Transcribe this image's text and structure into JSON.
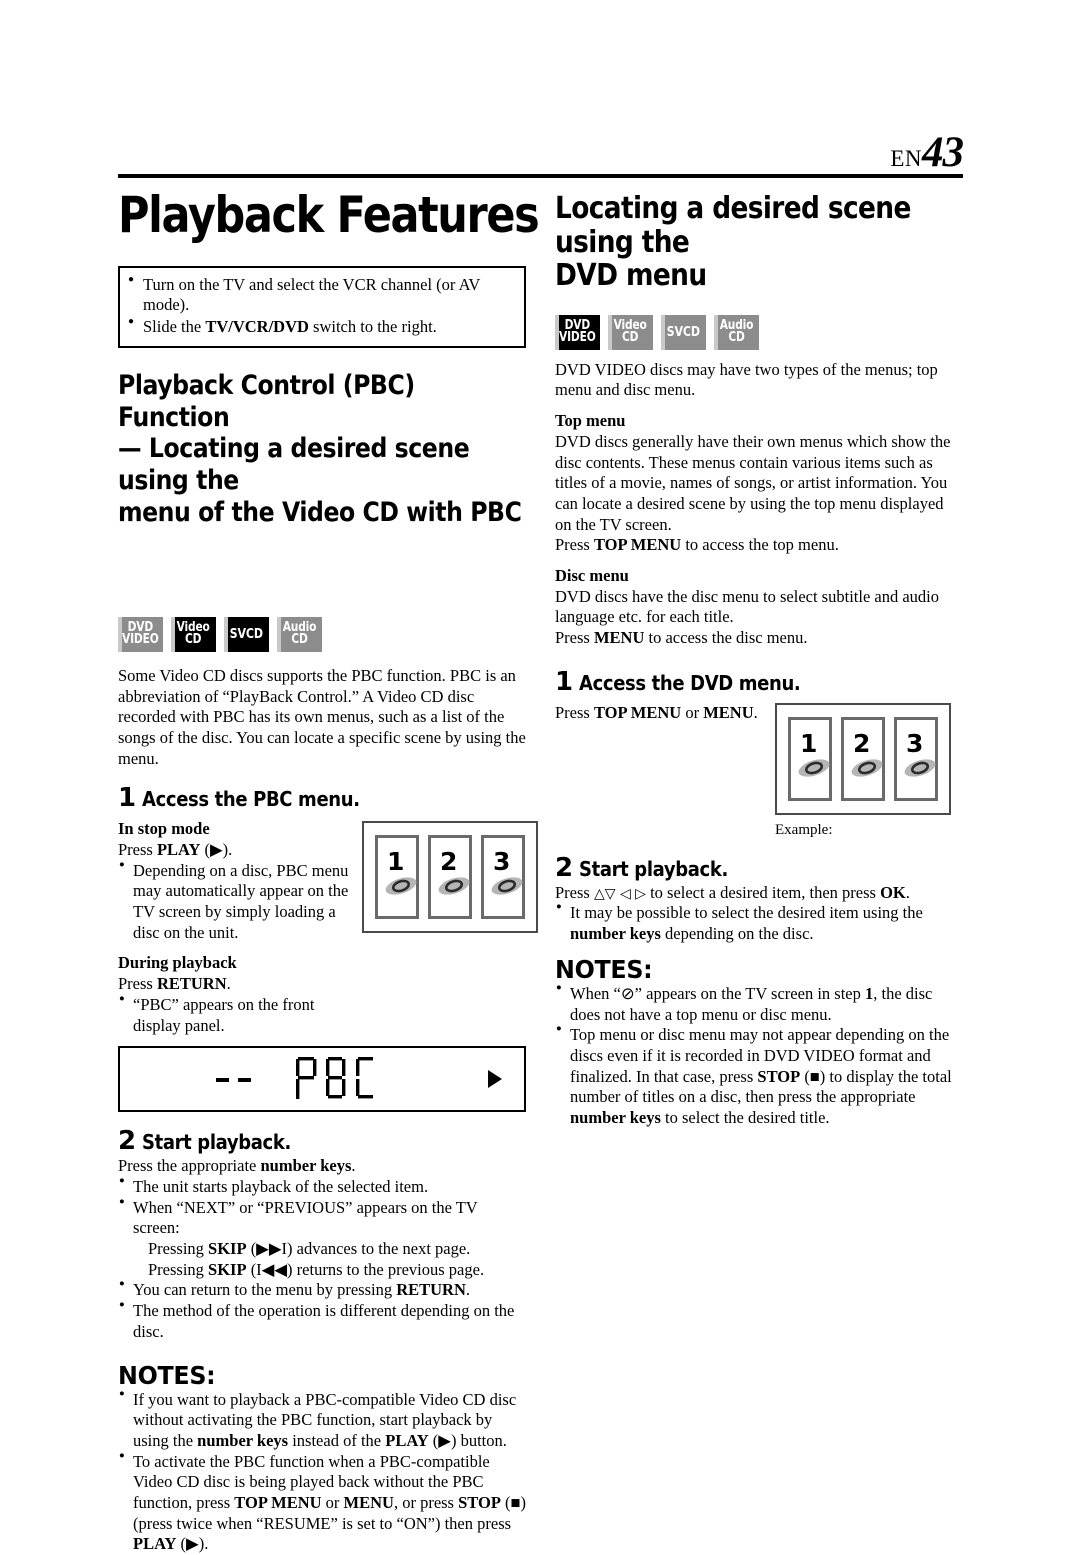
{
  "header": {
    "lang": "EN",
    "page_number": "43"
  },
  "left": {
    "title": "Playback Features",
    "prep_box": [
      "Turn on the TV and select the VCR channel (or AV mode).",
      "Slide the TV/VCR/DVD switch to the right."
    ],
    "prep_box_parts": {
      "b1_text": "Turn on the TV and select the VCR channel (or AV mode).",
      "b2_pre": "Slide the ",
      "b2_bold": "TV/VCR/DVD",
      "b2_post": " switch to the right."
    },
    "section_heading_line1": "Playback Control (PBC) Function",
    "section_heading_line2": "— Locating a desired scene using the",
    "section_heading_line3": "menu of the Video CD with PBC",
    "badges": [
      {
        "name": "dvd-video",
        "line1": "DVD",
        "line2": "VIDEO",
        "active": false
      },
      {
        "name": "video-cd",
        "line1": "Video",
        "line2": "CD",
        "active": true
      },
      {
        "name": "svcd",
        "line1": "SVCD",
        "line2": "",
        "active": true
      },
      {
        "name": "audio-cd",
        "line1": "Audio",
        "line2": "CD",
        "active": false
      }
    ],
    "intro": "Some Video CD discs supports the PBC function. PBC is an abbreviation of “PlayBack Control.” A Video CD disc recorded with PBC has its own menus, such as a list of the songs of the disc. You can locate a specific scene by using the menu.",
    "step1": {
      "number": "1",
      "title": "Access the PBC menu."
    },
    "stop_mode_heading": "In stop mode",
    "stop_mode_press_pre": "Press ",
    "stop_mode_press_bold": "PLAY",
    "stop_mode_press_post": " (▶).",
    "stop_mode_bullet": "Depending on a disc, PBC menu may automatically appear on the TV screen by simply loading a disc on the unit.",
    "during_playback_heading": "During playback",
    "during_playback_press_pre": "Press ",
    "during_playback_press_bold": "RETURN",
    "during_playback_press_post": ".",
    "during_playback_bullet": "“PBC” appears on the front display panel.",
    "lcd": {
      "text": "PBC",
      "dashes": 2,
      "play_indicator": "▶"
    },
    "tv_panels": [
      "1",
      "2",
      "3"
    ],
    "step2": {
      "number": "2",
      "title": "Start playback."
    },
    "step2_press_pre": "Press the appropriate ",
    "step2_press_bold": "number keys",
    "step2_press_post": ".",
    "step2_bullets": [
      {
        "text": "The unit starts playback of the selected item."
      },
      {
        "lead": "When “NEXT” or “PREVIOUS” appears on the TV screen:",
        "sub1_pre": "Pressing ",
        "sub1_bold": "SKIP",
        "sub1_post": " (▶▶I) advances to the next page.",
        "sub2_pre": "Pressing ",
        "sub2_bold": "SKIP",
        "sub2_post": " (I◀◀) returns to the previous page."
      },
      {
        "pre": "You can return to the menu by pressing ",
        "bold": "RETURN",
        "post": "."
      },
      {
        "text": "The method of the operation is different depending on the disc."
      }
    ],
    "notes_heading": "NOTES:",
    "notes": [
      {
        "p1": "If you want to playback a PBC-compatible Video CD disc without activating the PBC function, start playback by using the ",
        "b1": "number keys",
        "p2": " instead of the ",
        "b2": "PLAY",
        "p3": " (▶) button."
      },
      {
        "p1": "To activate the PBC function when a PBC-compatible Video CD disc is being played back without the PBC function, press ",
        "b1": "TOP MENU",
        "p2": " or ",
        "b2": "MENU",
        "p3": ", or press ",
        "b3": "STOP",
        "p4": " (■) (press twice when “RESUME” is set to “ON”) then press ",
        "b4": "PLAY",
        "p5": " (▶)."
      }
    ]
  },
  "right": {
    "title_line1": "Locating a desired scene using the",
    "title_line2": "DVD menu",
    "badges": [
      {
        "name": "dvd-video",
        "line1": "DVD",
        "line2": "VIDEO",
        "active": true
      },
      {
        "name": "video-cd",
        "line1": "Video",
        "line2": "CD",
        "active": false
      },
      {
        "name": "svcd",
        "line1": "SVCD",
        "line2": "",
        "active": false
      },
      {
        "name": "audio-cd",
        "line1": "Audio",
        "line2": "CD",
        "active": false
      }
    ],
    "intro": "DVD VIDEO discs may have two types of the menus; top menu and disc menu.",
    "top_menu_heading": "Top menu",
    "top_menu_body": "DVD discs generally have their own menus which show the disc contents. These menus contain various items such as titles of a movie, names of songs, or artist information. You can locate a desired scene by using the top menu displayed on the TV screen.",
    "top_menu_press_pre": "Press ",
    "top_menu_press_bold": "TOP MENU",
    "top_menu_press_post": " to access the top menu.",
    "disc_menu_heading": "Disc menu",
    "disc_menu_body": "DVD discs have the disc menu to select subtitle and audio language etc. for each title.",
    "disc_menu_press_pre": "Press ",
    "disc_menu_press_bold": "MENU",
    "disc_menu_press_post": " to access the disc menu.",
    "step1": {
      "number": "1",
      "title": "Access the DVD menu."
    },
    "step1_press_pre": "Press ",
    "step1_press_bold1": "TOP MENU",
    "step1_press_mid": " or ",
    "step1_press_bold2": "MENU",
    "step1_press_post": ".",
    "tv_panels": [
      "1",
      "2",
      "3"
    ],
    "example_label": "Example:",
    "step2": {
      "number": "2",
      "title": "Start playback."
    },
    "step2_press_pre": "Press ",
    "step2_arrows": "△▽ ◁ ▷",
    "step2_press_mid": " to select a desired item, then press ",
    "step2_press_bold": "OK",
    "step2_press_post": ".",
    "step2_bullet": {
      "pre": "It may be possible to select the desired item using the ",
      "bold": "number keys",
      "post": " depending on the disc."
    },
    "notes_heading": "NOTES:",
    "notes": [
      {
        "p1": "When “⊘” appears on the TV screen in step ",
        "b1": "1",
        "p2": ", the disc does not have a top menu or disc menu."
      },
      {
        "p1": "Top menu or disc menu may not appear depending on the discs even if it is recorded in DVD VIDEO format and finalized. In that case, press ",
        "b1": "STOP",
        "p2": " (■) to display the total number of titles on a disc, then press the appropriate ",
        "b2": "number keys",
        "p3": " to select the desired title."
      }
    ]
  },
  "colors": {
    "badge_active": "#000000",
    "badge_inactive": "#8c8c8c",
    "badge_stripe": "#c9c9c9",
    "disc_gray": "#b5b5b5",
    "panel_border": "#6a6a6a"
  }
}
